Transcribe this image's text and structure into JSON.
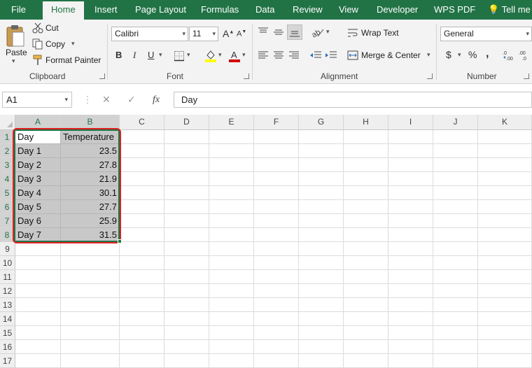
{
  "ribbon_tabs": [
    "File",
    "Home",
    "Insert",
    "Page Layout",
    "Formulas",
    "Data",
    "Review",
    "View",
    "Developer",
    "WPS PDF",
    "Tell me w"
  ],
  "active_tab": "Home",
  "clipboard": {
    "paste": "Paste",
    "cut": "Cut",
    "copy": "Copy",
    "format_painter": "Format Painter",
    "label": "Clipboard"
  },
  "font": {
    "name": "Calibri",
    "size": "11",
    "bold": "B",
    "italic": "I",
    "underline": "U",
    "grow": "A",
    "shrink": "A",
    "label": "Font"
  },
  "alignment": {
    "wrap_text": "Wrap Text",
    "merge_center": "Merge & Center",
    "label": "Alignment"
  },
  "number": {
    "format": "General",
    "currency": "$",
    "percent": "%",
    "comma": ",",
    "label": "Number"
  },
  "formula_bar": {
    "name_box": "A1",
    "cancel": "✕",
    "enter": "✓",
    "fx": "fx",
    "value": "Day"
  },
  "columns": [
    "A",
    "B",
    "C",
    "D",
    "E",
    "F",
    "G",
    "H",
    "I",
    "J",
    "K"
  ],
  "rows": [
    "1",
    "2",
    "3",
    "4",
    "5",
    "6",
    "7",
    "8",
    "9",
    "10",
    "11",
    "12",
    "13",
    "14",
    "15",
    "16",
    "17"
  ],
  "table": {
    "headers": [
      "Day",
      "Temperature"
    ],
    "rows": [
      [
        "Day 1",
        "23.5"
      ],
      [
        "Day 2",
        "27.8"
      ],
      [
        "Day 3",
        "21.9"
      ],
      [
        "Day 4",
        "30.1"
      ],
      [
        "Day 5",
        "27.7"
      ],
      [
        "Day 6",
        "25.9"
      ],
      [
        "Day 7",
        "31.5"
      ]
    ]
  },
  "colors": {
    "brand": "#217346",
    "highlight_box": "#e02020",
    "selection_fill": "#c8c8c8",
    "font_color": "#d00000",
    "fill_color": "#ffff00"
  }
}
